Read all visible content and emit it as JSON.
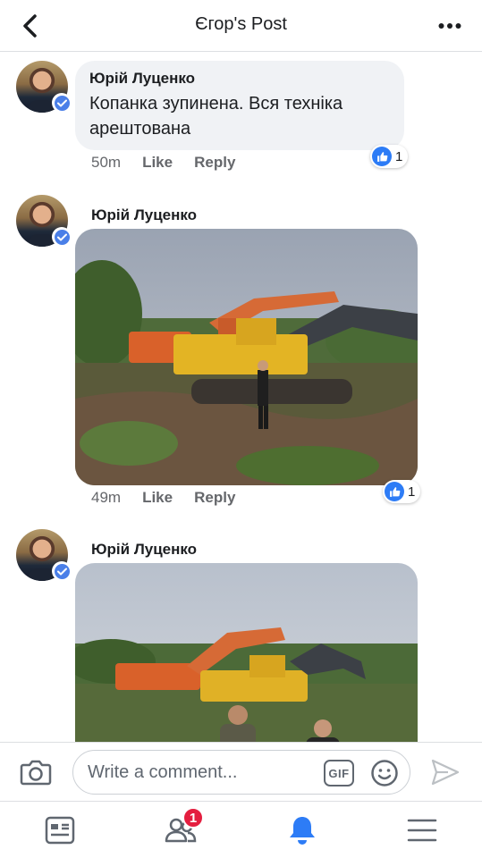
{
  "header": {
    "title": "Єгор's Post",
    "back_icon": "chevron-left-icon",
    "more_icon": "more-horizontal-icon"
  },
  "comments": [
    {
      "author": "Юрій Луценко",
      "verified": true,
      "text": "Копанка зупинена. Вся техніка арештована",
      "time": "50m",
      "like_label": "Like",
      "reply_label": "Reply",
      "reaction_count": "1"
    },
    {
      "author": "Юрій Луценко",
      "verified": true,
      "photo": "excavators-in-field",
      "time": "49m",
      "like_label": "Like",
      "reply_label": "Reply",
      "reaction_count": "1"
    },
    {
      "author": "Юрій Луценко",
      "verified": true,
      "photo": "excavators-with-people"
    }
  ],
  "composer": {
    "placeholder": "Write a comment...",
    "gif_label": "GIF",
    "camera_icon": "camera-icon",
    "emoji_icon": "emoji-icon",
    "send_icon": "send-icon"
  },
  "bottom_nav": {
    "items": [
      "news-feed-icon",
      "friends-icon",
      "notifications-icon",
      "menu-icon"
    ],
    "friend_requests_badge": "1"
  },
  "colors": {
    "accent": "#1877f2",
    "bubble": "#f0f2f5",
    "badge": "#e41e3f",
    "muted": "#65676b"
  }
}
